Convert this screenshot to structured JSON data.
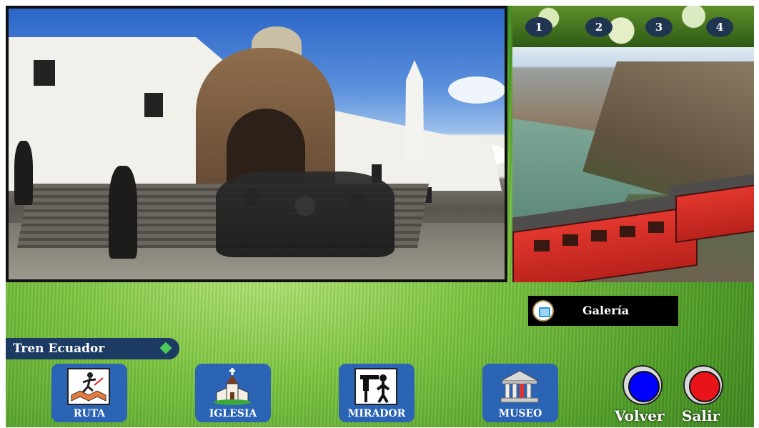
{
  "thumbnails": [
    "1",
    "2",
    "3",
    "4"
  ],
  "gallery": {
    "label": "Galería"
  },
  "title": {
    "text": "Tren Ecuador"
  },
  "nav": [
    {
      "id": "ruta",
      "label": "RUTA"
    },
    {
      "id": "iglesia",
      "label": "IGLESIA"
    },
    {
      "id": "mirador",
      "label": "MIRADOR"
    },
    {
      "id": "museo",
      "label": "MUSEO"
    }
  ],
  "actions": {
    "back_label": "Volver",
    "exit_label": "Salir"
  },
  "colors": {
    "back": "#0000ff",
    "exit": "#e8141a",
    "nav": "#2b64b4",
    "title_tab": "#1d3a63"
  }
}
